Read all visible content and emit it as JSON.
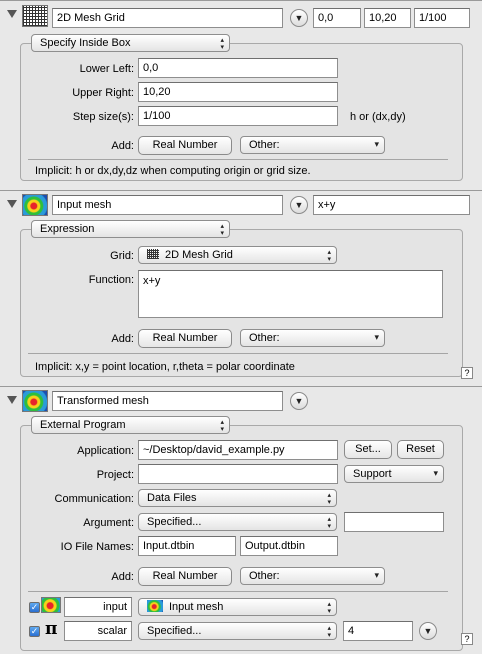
{
  "panel1": {
    "name": "2D Mesh Grid",
    "summary": [
      "0,0",
      "10,20",
      "1/100"
    ],
    "mode": "Specify Inside Box",
    "fields": [
      {
        "label": "Lower Left:",
        "value": "0,0"
      },
      {
        "label": "Upper Right:",
        "value": "10,20"
      },
      {
        "label": "Step size(s):",
        "value": "1/100"
      }
    ],
    "step_hint": "h or (dx,dy)",
    "add_label": "Add:",
    "add_button": "Real Number",
    "other_popup": "Other:",
    "implicit": "Implicit: h or dx,dy,dz when computing origin or grid size."
  },
  "panel2": {
    "name": "Input mesh",
    "summary": "x+y",
    "mode": "Expression",
    "grid_label": "Grid:",
    "grid_value": "2D Mesh Grid",
    "function_label": "Function:",
    "function_value": "x+y",
    "add_label": "Add:",
    "add_button": "Real Number",
    "other_popup": "Other:",
    "implicit": "Implicit: x,y = point location, r,theta = polar coordinate",
    "help": "?"
  },
  "panel3": {
    "name": "Transformed mesh",
    "mode": "External Program",
    "application_label": "Application:",
    "application_value": "~/Desktop/david_example.py",
    "set_button": "Set...",
    "reset_button": "Reset",
    "project_label": "Project:",
    "project_value": "",
    "support_popup": "Support",
    "communication_label": "Communication:",
    "communication_value": "Data Files",
    "argument_label": "Argument:",
    "argument_value": "Specified...",
    "argument_extra": "",
    "io_label": "IO File Names:",
    "io_input": "Input.dtbin",
    "io_output": "Output.dtbin",
    "add_label": "Add:",
    "add_button": "Real Number",
    "other_popup": "Other:",
    "inputs": [
      {
        "checked": true,
        "name": "input",
        "value": "Input mesh",
        "icon": "heatmap-icon"
      },
      {
        "checked": true,
        "name": "scalar",
        "value": "Specified...",
        "extra": "4",
        "icon": "pi-icon",
        "symbol": "π"
      }
    ],
    "help": "?"
  }
}
